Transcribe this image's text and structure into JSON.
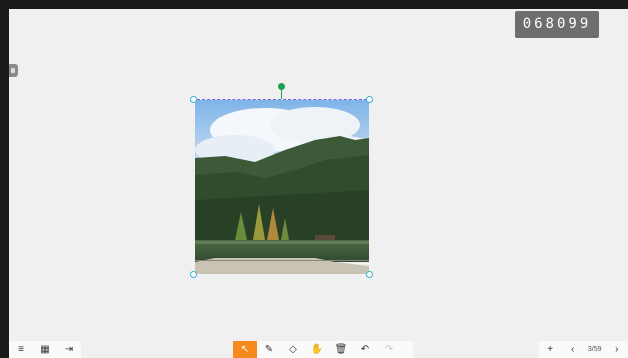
{
  "room_code": "068099",
  "left_toolbar": {
    "menu_icon": "≡",
    "qr_icon": "▦",
    "exit_icon": "⇥"
  },
  "center_toolbar": {
    "select_icon": "↖",
    "pen_icon": "✎",
    "eraser_icon": "◇",
    "hand_icon": "✋",
    "delete_icon": "🗑",
    "undo_icon": "↶",
    "redo_icon": "↷"
  },
  "right_toolbar": {
    "add_icon": "+",
    "prev_icon": "‹",
    "page_indicator": "3/59",
    "next_icon": "›"
  },
  "colors": {
    "accent": "#f68a1e",
    "canvas": "#f0f0f0",
    "rotate_handle": "#1aa052"
  }
}
